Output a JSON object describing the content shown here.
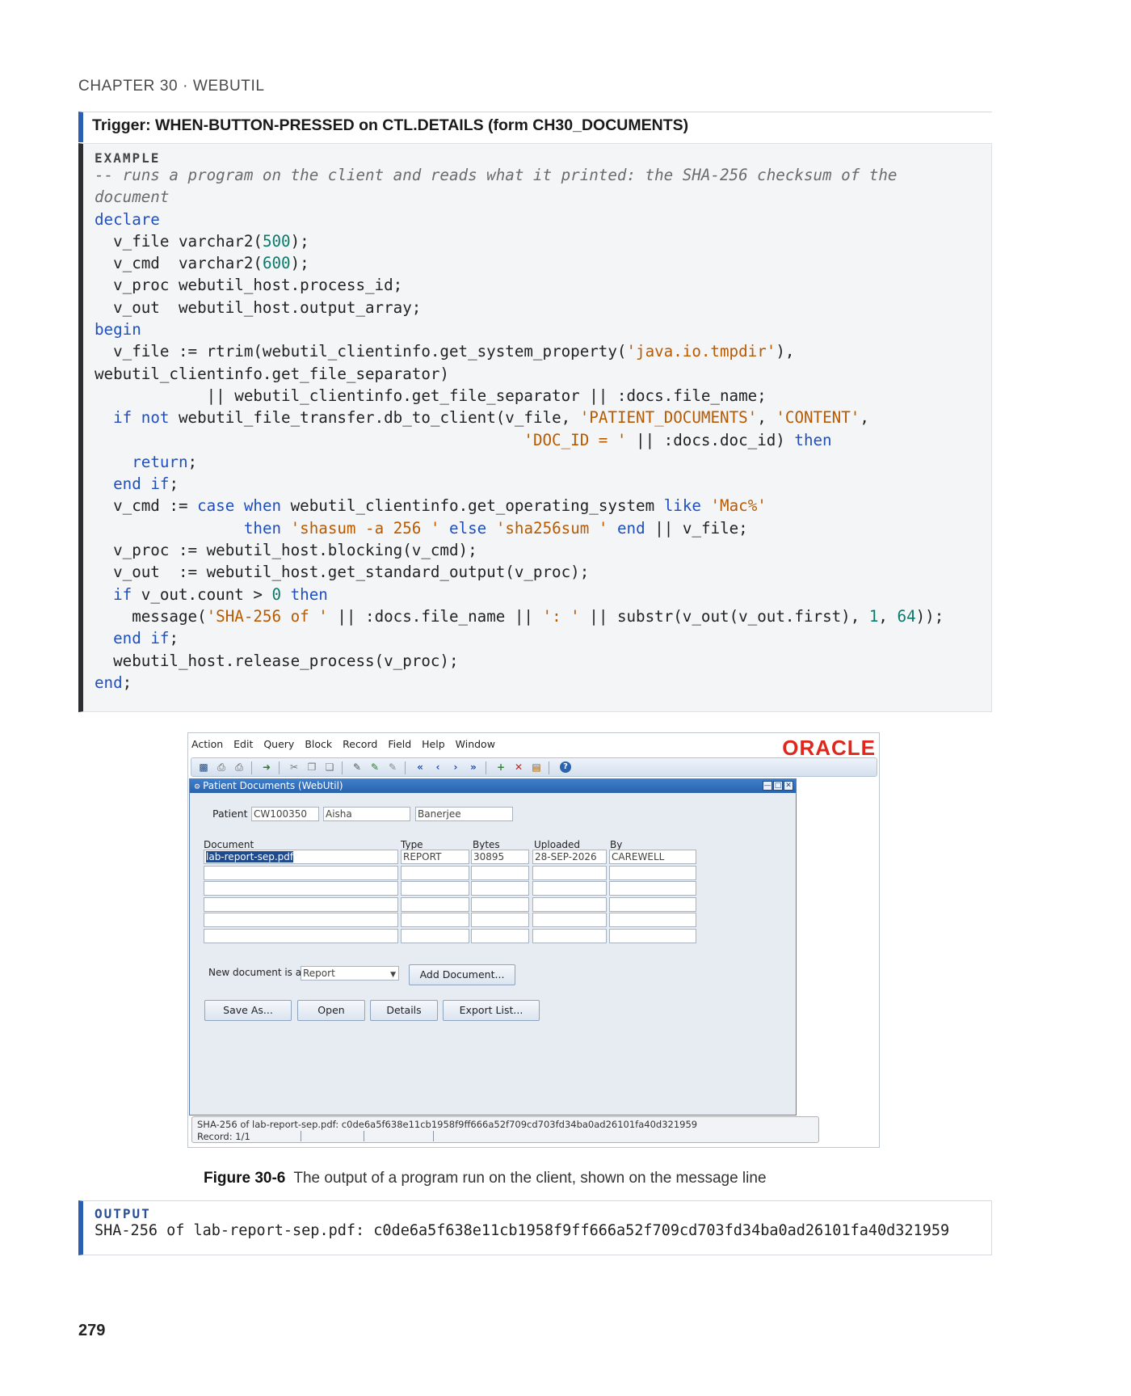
{
  "chapter": "CHAPTER 30 · WEBUTIL",
  "trigger_title": "Trigger: WHEN-BUTTON-PRESSED on CTL.DETAILS (form CH30_DOCUMENTS)",
  "example": {
    "label": "EXAMPLE",
    "code": [
      "-- runs a program on the client and reads what it printed: the SHA-256 checksum of the",
      "document",
      "declare",
      "  v_file varchar2(500);",
      "  v_cmd  varchar2(600);",
      "  v_proc webutil_host.process_id;",
      "  v_out  webutil_host.output_array;",
      "begin",
      "  v_file := rtrim(webutil_clientinfo.get_system_property('java.io.tmpdir'),",
      "webutil_clientinfo.get_file_separator)",
      "            || webutil_clientinfo.get_file_separator || :docs.file_name;",
      "  if not webutil_file_transfer.db_to_client(v_file, 'PATIENT_DOCUMENTS', 'CONTENT',",
      "                                              'DOC_ID = ' || :docs.doc_id) then",
      "    return;",
      "  end if;",
      "  v_cmd := case when webutil_clientinfo.get_operating_system like 'Mac%'",
      "                then 'shasum -a 256 ' else 'sha256sum ' end || v_file;",
      "  v_proc := webutil_host.blocking(v_cmd);",
      "  v_out  := webutil_host.get_standard_output(v_proc);",
      "  if v_out.count > 0 then",
      "    message('SHA-256 of ' || :docs.file_name || ': ' || substr(v_out(v_out.first), 1, 64));",
      "  end if;",
      "  webutil_host.release_process(v_proc);",
      "end;"
    ]
  },
  "screenshot": {
    "menu": [
      "Action",
      "Edit",
      "Query",
      "Block",
      "Record",
      "Field",
      "Help",
      "Window"
    ],
    "logo": "ORACLE",
    "window_title": "Patient Documents (WebUtil)",
    "patient_label": "Patient",
    "patient_id": "CW100350",
    "patient_first": "Aisha",
    "patient_last": "Banerjee",
    "columns": [
      "Document",
      "Type",
      "Bytes",
      "Uploaded",
      "By"
    ],
    "rows": [
      [
        "lab-report-sep.pdf",
        "REPORT",
        "30895",
        "28-SEP-2026",
        "CAREWELL"
      ],
      [
        "",
        "",
        "",
        "",
        ""
      ],
      [
        "",
        "",
        "",
        "",
        ""
      ],
      [
        "",
        "",
        "",
        "",
        ""
      ],
      [
        "",
        "",
        "",
        "",
        ""
      ],
      [
        "",
        "",
        "",
        "",
        ""
      ]
    ],
    "new_doc_label": "New document is a",
    "doc_type_value": "Report",
    "buttons": {
      "add_document": "Add Document...",
      "save_as": "Save As...",
      "open": "Open",
      "details": "Details",
      "export_list": "Export List..."
    },
    "status_message": "SHA-256 of lab-report-sep.pdf: c0de6a5f638e11cb1958f9ff666a52f709cd703fd34ba0ad26101fa40d321959",
    "record": "Record: 1/1"
  },
  "caption": {
    "label": "Figure 30-6",
    "text": "The output of a program run on the client, shown on the message line"
  },
  "output": {
    "label": "OUTPUT",
    "text": "SHA-256 of lab-report-sep.pdf: c0de6a5f638e11cb1958f9ff666a52f709cd703fd34ba0ad26101fa40d321959"
  },
  "page_number": "279"
}
